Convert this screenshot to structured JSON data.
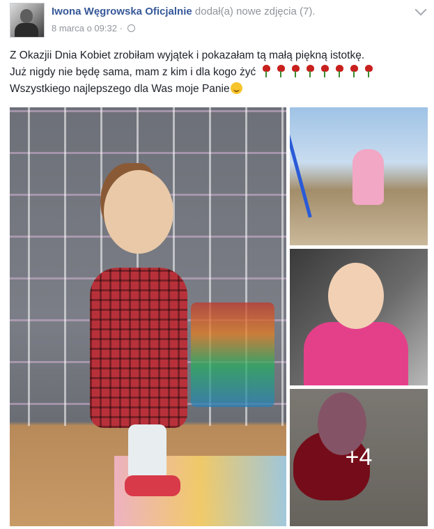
{
  "post": {
    "author": "Iwona Węgrowska Oficjalnie",
    "action": "dodał(a) nowe zdjęcia (7).",
    "timestamp": "8 marca o 09:32",
    "separator": "·",
    "privacy_icon": "globe-icon",
    "menu_icon": "chevron-down-icon"
  },
  "text": {
    "line1": "Z Okazjii Dnia Kobiet zrobiłam wyjątek i pokazałam tą małą piękną istotkę.",
    "line2": "Już nigdy nie będę sama, mam z kim i dla kogo żyć",
    "line2_emoji": "rose-emoji",
    "line2_emoji_count": 8,
    "line3": "Wszystkiego najlepszego dla Was moje Panie",
    "line3_emoji": "smiling-face-emoji"
  },
  "photos": {
    "extra_count": "+4"
  },
  "colors": {
    "author_link": "#365899",
    "meta_gray": "#90949c",
    "body_text": "#1d2129"
  }
}
